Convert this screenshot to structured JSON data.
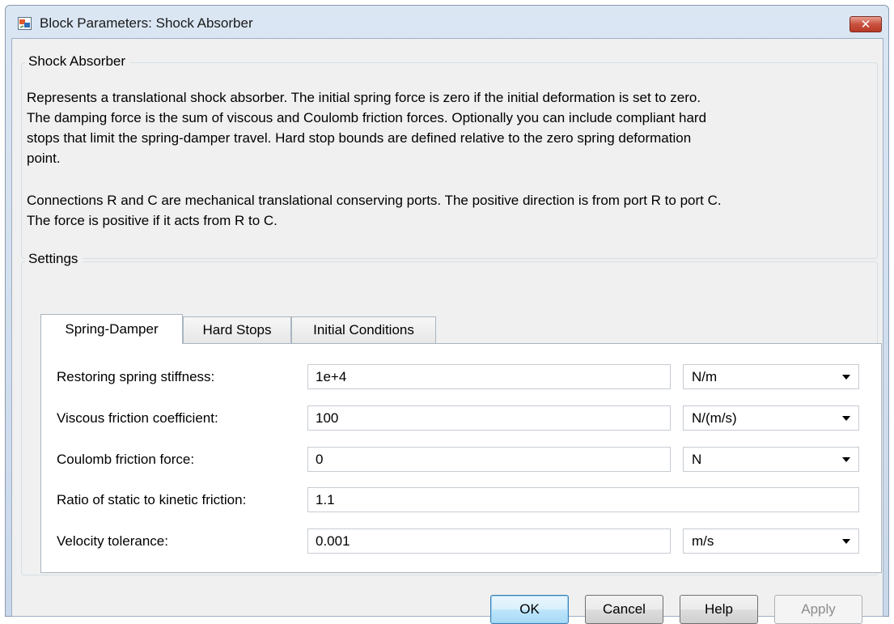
{
  "window": {
    "title": "Block Parameters: Shock Absorber",
    "close_glyph": "✕"
  },
  "description_group": {
    "title": "Shock Absorber",
    "paragraph1_lines": [
      "Represents a translational shock absorber. The initial spring force is zero if the initial deformation is set to zero.",
      "The damping force is the sum of viscous and Coulomb friction forces. Optionally you can include compliant hard",
      "stops that limit the spring-damper travel. Hard stop bounds are defined relative to the zero spring deformation",
      "point."
    ],
    "paragraph2_lines": [
      "Connections R and C are mechanical translational conserving ports. The positive direction is from port R to port C.",
      "The force is positive if it acts from R to C."
    ]
  },
  "settings": {
    "title": "Settings",
    "tabs": [
      {
        "label": "Spring-Damper",
        "active": true
      },
      {
        "label": "Hard Stops",
        "active": false
      },
      {
        "label": "Initial Conditions",
        "active": false
      }
    ],
    "params": [
      {
        "label": "Restoring spring stiffness:",
        "value": "1e+4",
        "unit": "N/m"
      },
      {
        "label": "Viscous friction coefficient:",
        "value": "100",
        "unit": "N/(m/s)"
      },
      {
        "label": "Coulomb friction force:",
        "value": "0",
        "unit": "N"
      },
      {
        "label": "Ratio of static to kinetic friction:",
        "value": "1.1",
        "unit": ""
      },
      {
        "label": "Velocity tolerance:",
        "value": "0.001",
        "unit": "m/s"
      }
    ]
  },
  "buttons": {
    "ok": "OK",
    "cancel": "Cancel",
    "help": "Help",
    "apply": "Apply"
  }
}
